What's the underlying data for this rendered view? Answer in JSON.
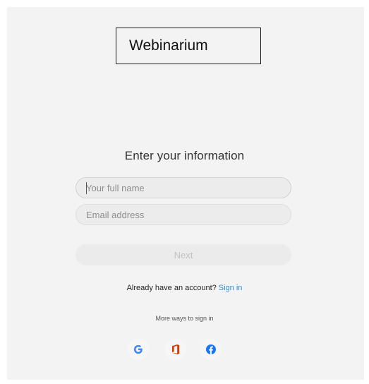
{
  "brand": {
    "name": "Webinarium"
  },
  "form": {
    "heading": "Enter your information",
    "name_placeholder": "Your full name",
    "email_placeholder": "Email address",
    "next_label": "Next"
  },
  "account": {
    "prompt": "Already have an account?",
    "sign_in_link": "Sign in"
  },
  "more_ways": {
    "label": "More ways to sign in",
    "providers": [
      {
        "icon": "google-icon"
      },
      {
        "icon": "office-icon"
      },
      {
        "icon": "facebook-icon"
      }
    ]
  },
  "colors": {
    "link": "#2f8fd8",
    "google_blue": "#4285f4",
    "office_red": "#d83b01",
    "facebook_blue": "#1877f2",
    "panel_background": "#f3f3f3"
  }
}
